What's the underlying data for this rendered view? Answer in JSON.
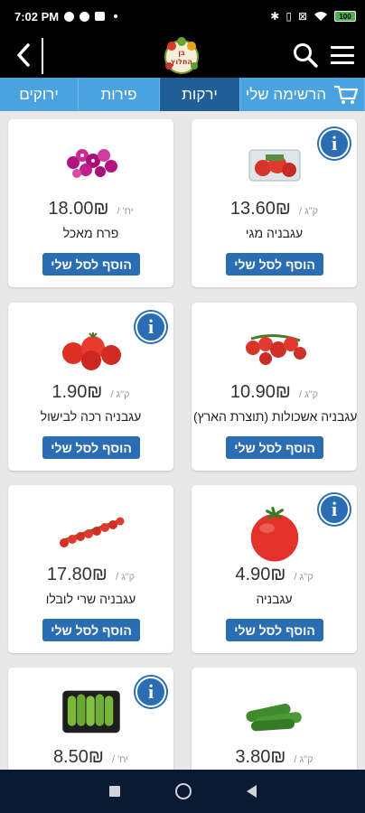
{
  "status_bar": {
    "time": "7:02 PM",
    "battery": "100"
  },
  "header": {
    "logo_text": "בן החלוץ",
    "back_icon": "chevron-left-icon",
    "search_icon": "search-icon",
    "menu_icon": "hamburger-menu-icon"
  },
  "tabs": [
    {
      "label": "ירוקים",
      "active": false
    },
    {
      "label": "פירות",
      "active": false
    },
    {
      "label": "ירקות",
      "active": true
    },
    {
      "label": "הרשימה שלי",
      "active": false,
      "icon": "shopping-cart-icon"
    }
  ],
  "products": [
    {
      "name": "עגבניה מגי",
      "price": "13.60₪",
      "unit": "ק\"ג /",
      "has_info": true,
      "image": "packed-tomatoes"
    },
    {
      "name": "פרח מאכל",
      "price": "18.00₪",
      "unit": "יח' /",
      "has_info": false,
      "image": "edible-flowers"
    },
    {
      "name": "עגבניה אשכולות (תוצרת הארץ)",
      "price": "10.90₪",
      "unit": "ק\"ג /",
      "has_info": false,
      "image": "vine-tomatoes"
    },
    {
      "name": "עגבניה רכה לבישול",
      "price": "1.90₪",
      "unit": "ק\"ג /",
      "has_info": true,
      "image": "soft-tomatoes"
    },
    {
      "name": "עגבניה",
      "price": "4.90₪",
      "unit": "ק\"ג /",
      "has_info": true,
      "image": "single-tomato"
    },
    {
      "name": "עגבניה שרי לובלו",
      "price": "17.80₪",
      "unit": "ק\"ג /",
      "has_info": false,
      "image": "cherry-tomatoes"
    },
    {
      "name": "",
      "price": "3.80₪",
      "unit": "ק\"ג /",
      "has_info": false,
      "image": "cucumbers"
    },
    {
      "name": "",
      "price": "8.50₪",
      "unit": "יח' /",
      "has_info": true,
      "image": "packed-cucumbers"
    }
  ],
  "add_to_cart_label": "הוסף לסל שלי",
  "colors": {
    "tab_active": "#1f5e96",
    "tab_inactive": "#4aa3df",
    "button_blue": "#2a6db3",
    "header_black": "#000000",
    "nav_bar": "#0b1a33"
  }
}
